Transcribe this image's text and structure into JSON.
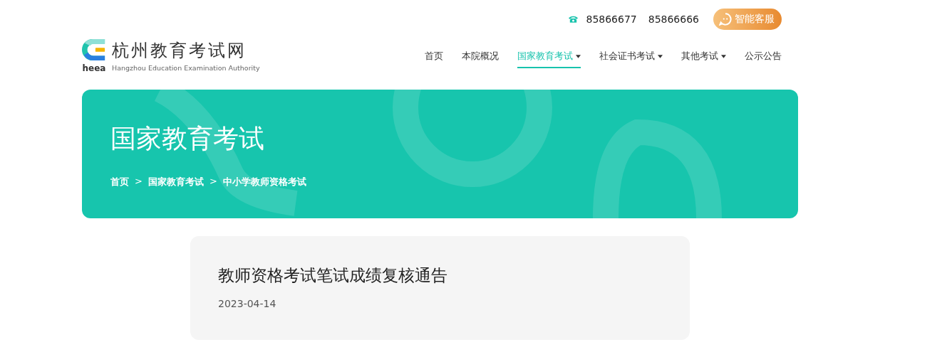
{
  "header": {
    "phones": [
      "85866677",
      "85866666"
    ],
    "service_button": "智能客服",
    "logo": {
      "mark_text": "heea",
      "title": "杭州教育考试网",
      "subtitle": "Hangzhou Education Examination Authority"
    },
    "nav": [
      {
        "label": "首页",
        "selected": false,
        "has_menu": false
      },
      {
        "label": "本院概况",
        "selected": false,
        "has_menu": false
      },
      {
        "label": "国家教育考试",
        "selected": true,
        "has_menu": true
      },
      {
        "label": "社会证书考试",
        "selected": false,
        "has_menu": true
      },
      {
        "label": "其他考试",
        "selected": false,
        "has_menu": true
      },
      {
        "label": "公示公告",
        "selected": false,
        "has_menu": false
      }
    ]
  },
  "banner": {
    "title": "国家教育考试",
    "breadcrumb": [
      {
        "label": "首页",
        "separator": ">"
      },
      {
        "label": "国家教育考试",
        "separator": ">"
      },
      {
        "label": "中小学教师资格考试"
      }
    ]
  },
  "article": {
    "title": "教师资格考试笔试成绩复核通告",
    "date": "2023-04-14"
  }
}
